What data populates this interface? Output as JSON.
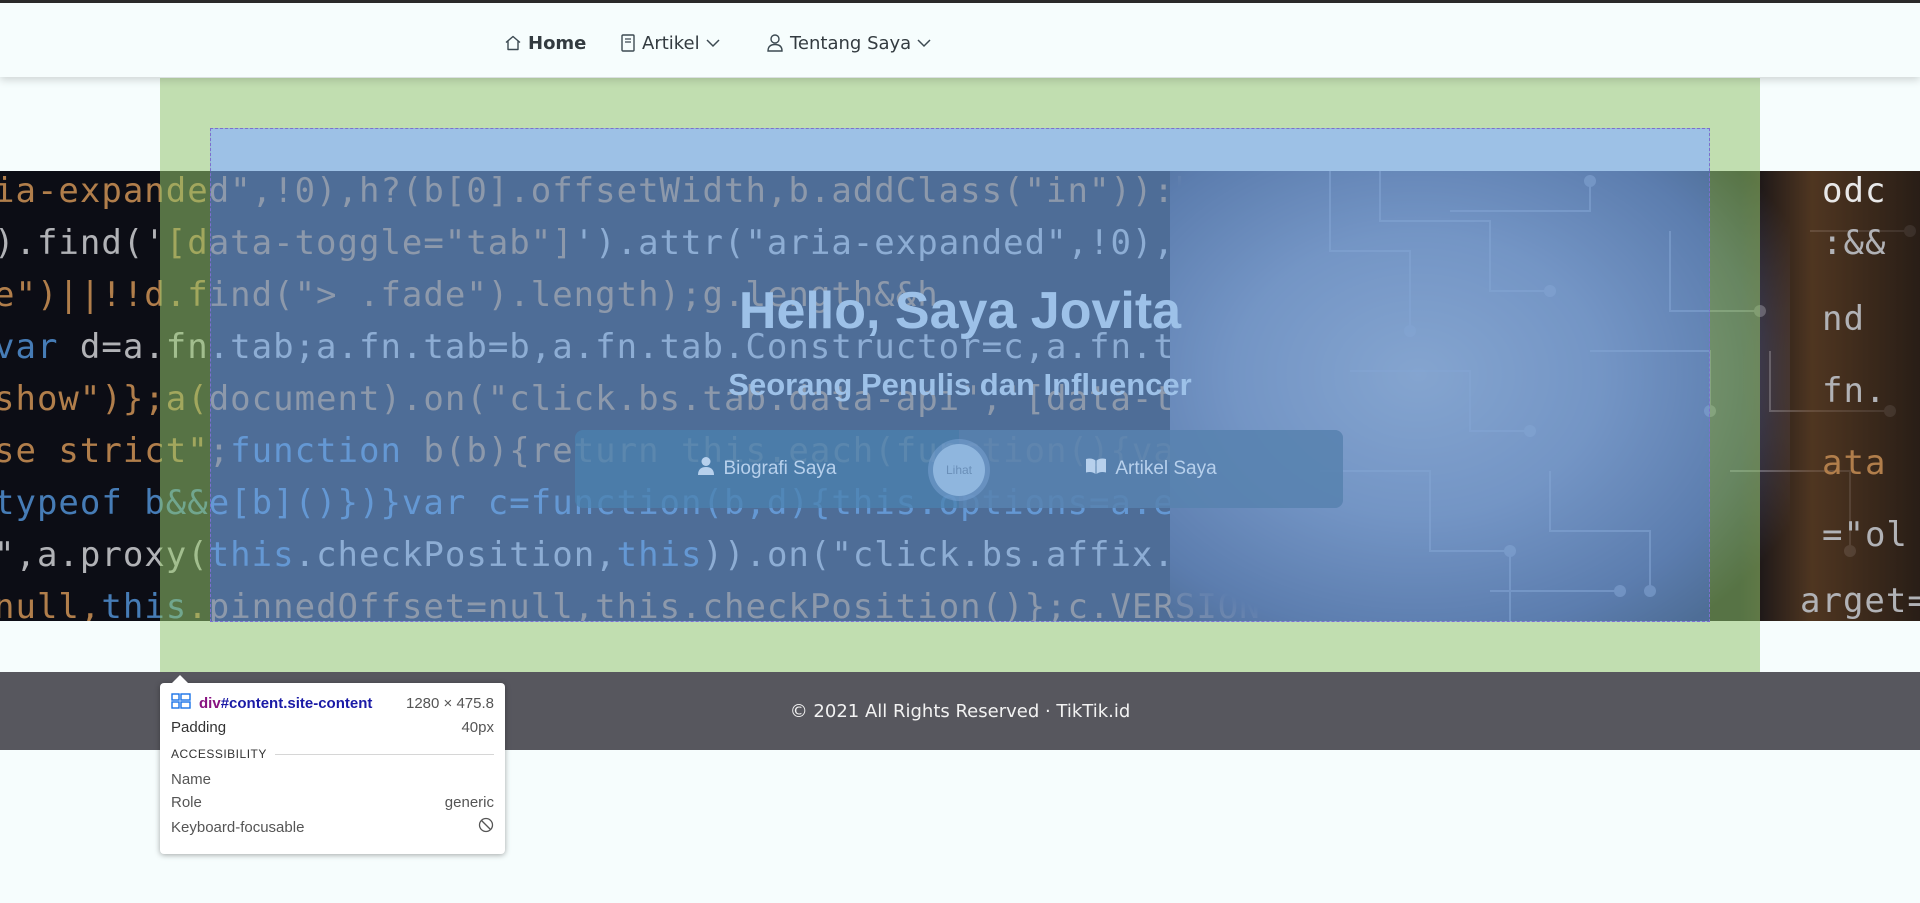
{
  "nav": {
    "home_label": "Home",
    "artikel_label": "Artikel",
    "tentang_label": "Tentang Saya",
    "icons": [
      "home-icon",
      "book-icon",
      "user-icon",
      "chevron-down-icon"
    ]
  },
  "hero": {
    "title": "Hello, Saya Jovita",
    "subtitle": "Seorang Penulis dan Influencer",
    "biografi_button": "Biografi Saya",
    "lihat_button": "Lihat",
    "artikel_button": "Artikel Saya"
  },
  "footer": {
    "text": "© 2021 All Rights Reserved · TikTik.id"
  },
  "inspector": {
    "tag": "div",
    "selector": "#content.site-content",
    "size": "1280 × 475.8",
    "padding_label": "Padding",
    "padding_value": "40px",
    "section_title": "ACCESSIBILITY",
    "name_label": "Name",
    "name_value": "",
    "role_label": "Role",
    "role_value": "generic",
    "keyboard_label": "Keyboard-focusable",
    "keyboard_icon": "not-focusable-icon"
  },
  "colors": {
    "padding_overlay": "#c1deb0",
    "content_overlay": "#9dc1e6",
    "footer_bg": "#57575e",
    "navbar_bg": "#f6fdfd",
    "hero_text": "#9dc1e8"
  }
}
